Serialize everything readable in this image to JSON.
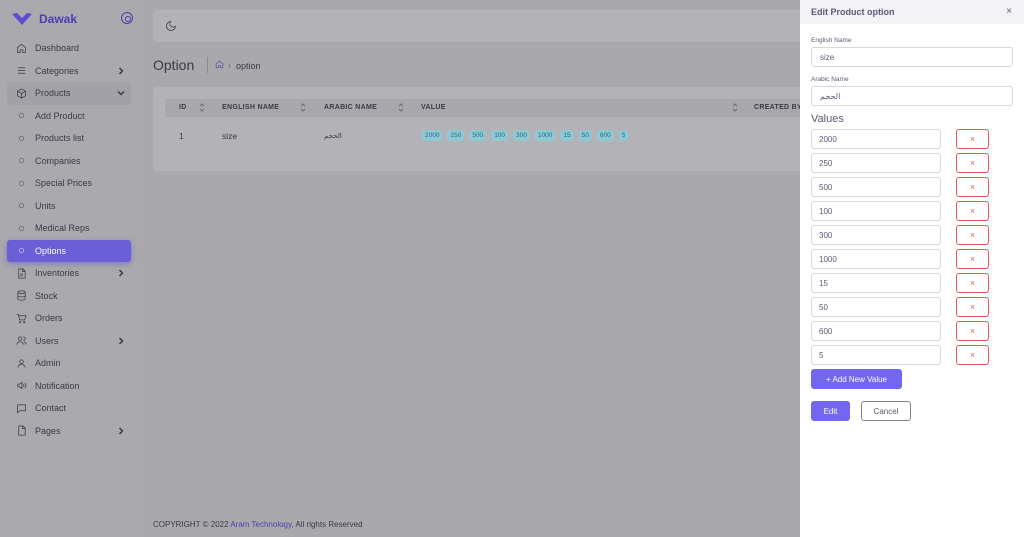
{
  "brand": {
    "name": "Dawak"
  },
  "sidebar": {
    "items": [
      {
        "label": "Dashboard",
        "icon": "home-icon"
      },
      {
        "label": "Categories",
        "icon": "list-icon",
        "chevron": "right"
      },
      {
        "label": "Products",
        "icon": "box-icon",
        "chevron": "down"
      },
      {
        "label": "Add Product",
        "icon": "circle-icon"
      },
      {
        "label": "Products list",
        "icon": "circle-icon"
      },
      {
        "label": "Companies",
        "icon": "circle-icon"
      },
      {
        "label": "Special Prices",
        "icon": "circle-icon"
      },
      {
        "label": "Units",
        "icon": "circle-icon"
      },
      {
        "label": "Medical Reps",
        "icon": "circle-icon"
      },
      {
        "label": "Options",
        "icon": "circle-icon"
      },
      {
        "label": "Inventories",
        "icon": "file-icon",
        "chevron": "right"
      },
      {
        "label": "Stock",
        "icon": "database-icon"
      },
      {
        "label": "Orders",
        "icon": "cart-icon"
      },
      {
        "label": "Users",
        "icon": "users-icon",
        "chevron": "right"
      },
      {
        "label": "Admin",
        "icon": "user-icon"
      },
      {
        "label": "Notification",
        "icon": "volume-icon"
      },
      {
        "label": "Contact",
        "icon": "message-icon"
      },
      {
        "label": "Pages",
        "icon": "page-icon",
        "chevron": "right"
      }
    ]
  },
  "page": {
    "title": "Option",
    "breadcrumb": "option"
  },
  "table": {
    "headers": {
      "id": "ID",
      "english_name": "ENGLISH NAME",
      "arabic_name": "ARABIC NAME",
      "value": "VALUE",
      "created_by": "CREATED BY"
    },
    "row": {
      "id": "1",
      "english_name": "size",
      "arabic_name": "الحجم",
      "values": [
        "2000",
        "250",
        "500",
        "100",
        "300",
        "1000",
        "15",
        "50",
        "600",
        "5"
      ]
    }
  },
  "footer": {
    "prefix": "COPYRIGHT © 2022",
    "link": "Aram Technology",
    "suffix": ", All rights Reserved"
  },
  "drawer": {
    "title": "Edit Product option",
    "close": "×",
    "english_label": "English Name",
    "english_value": "size",
    "arabic_label": "Arabic Name",
    "arabic_value": "الحجم",
    "values_title": "Values",
    "values": [
      "2000",
      "250",
      "500",
      "100",
      "300",
      "1000",
      "15",
      "50",
      "600",
      "5"
    ],
    "delete_label": "×",
    "add_label": "+ Add New Value",
    "edit_label": "Edit",
    "cancel_label": "Cancel"
  },
  "colors": {
    "accent": "#7367f0",
    "danger": "#ea5455",
    "overlay": "#a8a8ad",
    "chip_bg": "#8fc7d3",
    "chip_text": "#1a6f86"
  }
}
